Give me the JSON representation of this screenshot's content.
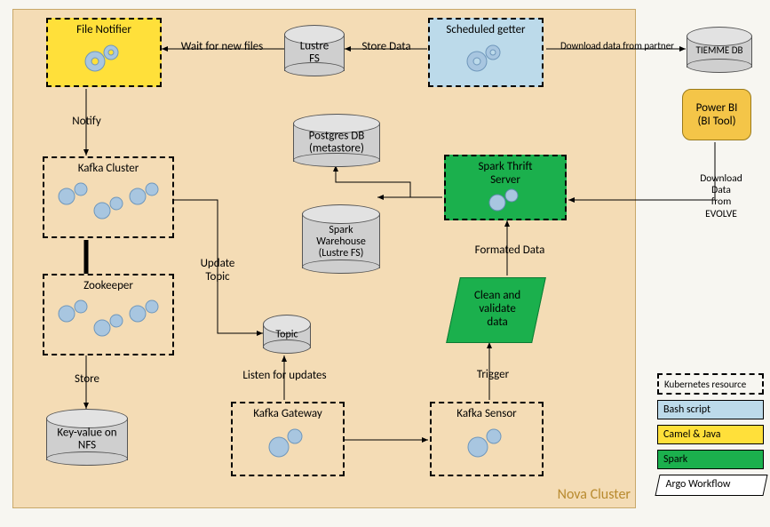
{
  "cluster": {
    "title": "Nova Cluster"
  },
  "nodes": {
    "file_notifier": "File Notifier",
    "scheduled_getter": "Scheduled getter",
    "lustre_fs": "Lustre\nFS",
    "tiemme_db": "TIEMME DB",
    "power_bi": "Power BI\n(BI Tool)",
    "kafka_cluster": "Kafka Cluster",
    "zookeeper": "Zookeeper",
    "key_value_nfs": "Key-value on\nNFS",
    "postgres": "Postgres DB\n(metastore)",
    "spark_wh": "Spark\nWarehouse\n(Lustre FS)",
    "spark_thrift": "Spark Thrift\nServer",
    "clean_validate": "Clean and\nvalidate\ndata",
    "topic": "Topic",
    "kafka_gateway": "Kafka Gateway",
    "kafka_sensor": "Kafka Sensor"
  },
  "edges": {
    "wait_files": "Wait for new files",
    "store_data": "Store Data",
    "download_partner": "Download data from partner",
    "notify": "Notify",
    "update_topic": "Update\nTopic",
    "listen_updates": "Listen for updates",
    "store": "Store",
    "trigger": "Trigger",
    "formatted_data": "Formated Data",
    "download_evolve": "Download\nData\nfrom\nEVOLVE"
  },
  "legend": {
    "title": "Kubernetes resource",
    "bash": "Bash script",
    "camel": "Camel & Java",
    "spark": "Spark",
    "argo": "Argo Workflow"
  },
  "colors": {
    "bash": "#bcdaea",
    "camel": "#ffe03a",
    "spark": "#1bb04d",
    "argo": "#ffffff",
    "powerbi": "#f4c548",
    "cluster_bg": "#f4dcb5",
    "gear": "#a8c6e0"
  }
}
